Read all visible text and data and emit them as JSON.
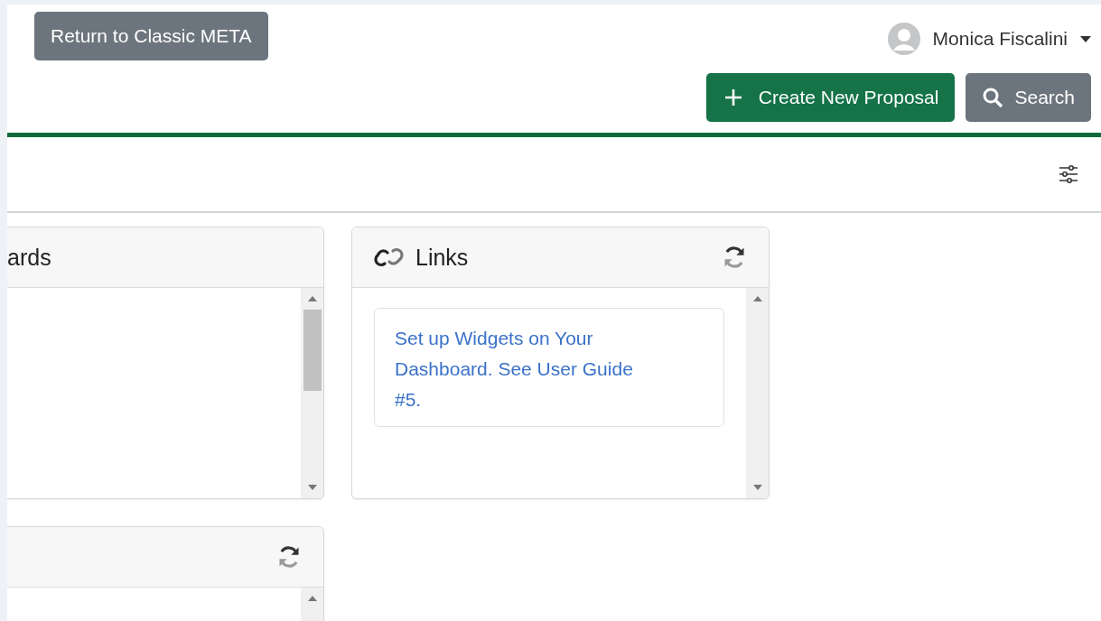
{
  "header": {
    "classic_button": "Return to Classic META",
    "user_name": "Monica Fiscalini",
    "create_button": "Create New Proposal",
    "search_button": "Search"
  },
  "widgets": [
    {
      "title": "ards",
      "refresh": false,
      "scroll_thumb": true
    },
    {
      "title": "Links",
      "kind": "links",
      "refresh": true,
      "scroll_thumb": false,
      "links": [
        "Set up Widgets on Your Dashboard. See User Guide #5."
      ]
    },
    {
      "refresh": true,
      "scroll_thumb": false
    }
  ]
}
